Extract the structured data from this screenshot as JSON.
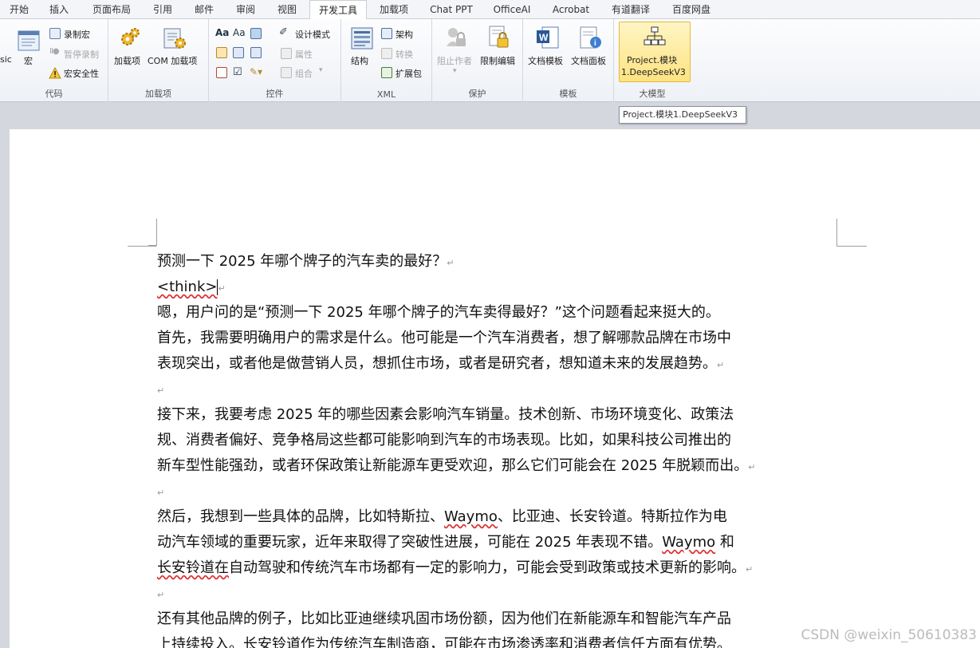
{
  "tabs": [
    {
      "label": "开始"
    },
    {
      "label": "插入"
    },
    {
      "label": "页面布局"
    },
    {
      "label": "引用"
    },
    {
      "label": "邮件"
    },
    {
      "label": "审阅"
    },
    {
      "label": "视图"
    },
    {
      "label": "开发工具"
    },
    {
      "label": "加载项"
    },
    {
      "label": "Chat PPT"
    },
    {
      "label": "OfficeAI"
    },
    {
      "label": "Acrobat"
    },
    {
      "label": "有道翻译"
    },
    {
      "label": "百度网盘"
    }
  ],
  "ribbon": {
    "code": {
      "label": "代码",
      "vb_partial": "sic",
      "macro": "宏",
      "record": "录制宏",
      "pause": "暂停录制",
      "security": "宏安全性"
    },
    "addins": {
      "label": "加载项",
      "addin": "加载项",
      "com": "COM 加载项"
    },
    "controls": {
      "label": "控件",
      "design_mode": "设计模式",
      "properties": "属性",
      "group": "组合"
    },
    "xml": {
      "label": "XML",
      "structure": "结构",
      "schema": "架构",
      "transform": "转换",
      "expansion": "扩展包"
    },
    "protect": {
      "label": "保护",
      "block_authors": "阻止作者",
      "restrict_editing": "限制编辑"
    },
    "templates": {
      "label": "模板",
      "doc_template": "文档模板",
      "doc_panel": "文档面板"
    },
    "llm": {
      "label": "大模型",
      "button_line1": "Project.模块",
      "button_line2": "1.DeepSeekV3"
    }
  },
  "tooltip": "Project.模块1.DeepSeekV3",
  "document": {
    "line1": "预测一下 2025 年哪个牌子的汽车卖的最好？",
    "think": "<think>",
    "p1": [
      "嗯，用户问的是“预测一下 2025 年哪个牌子的汽车卖得最好？”这个问题看起来挺大的。",
      "首先，我需要明确用户的需求是什么。他可能是一个汽车消费者，想了解哪款品牌在市场中",
      "表现突出，或者他是做营销人员，想抓住市场，或者是研究者，想知道未来的发展趋势。"
    ],
    "p2": [
      "接下来，我要考虑 2025 年的哪些因素会影响汽车销量。技术创新、市场环境变化、政策法",
      "规、消费者偏好、竞争格局这些都可能影响到汽车的市场表现。比如，如果科技公司推出的",
      "新车型性能强劲，或者环保政策让新能源车更受欢迎，那么它们可能会在 2025 年脱颖而出。"
    ],
    "p3_l1_a": "然后，我想到一些具体的品牌，比如特斯拉、",
    "waymo": "Waymo",
    "p3_l1_b": "、比亚迪、长安铃道。特斯拉作为电",
    "p3_l2_a": "动汽车领域的重要玩家，近年来取得了突破性进展，可能在 2025 年表现不错。",
    "p3_l2_b": " 和",
    "p3_l3_a": "长安铃道在",
    "p3_l3_b": "自动驾驶和传统汽车市场都有一定的影响力，可能会受到政策或技术更新的影响。",
    "p4": [
      "还有其他品牌的例子，比如比亚迪继续巩固市场份额，因为他们在新能源车和智能汽车产品",
      "上持续投入。长安铃道作为传统汽车制造商，可能在市场渗透率和消费者信任方面有优势。"
    ]
  },
  "watermark": "CSDN @weixin_50610383"
}
